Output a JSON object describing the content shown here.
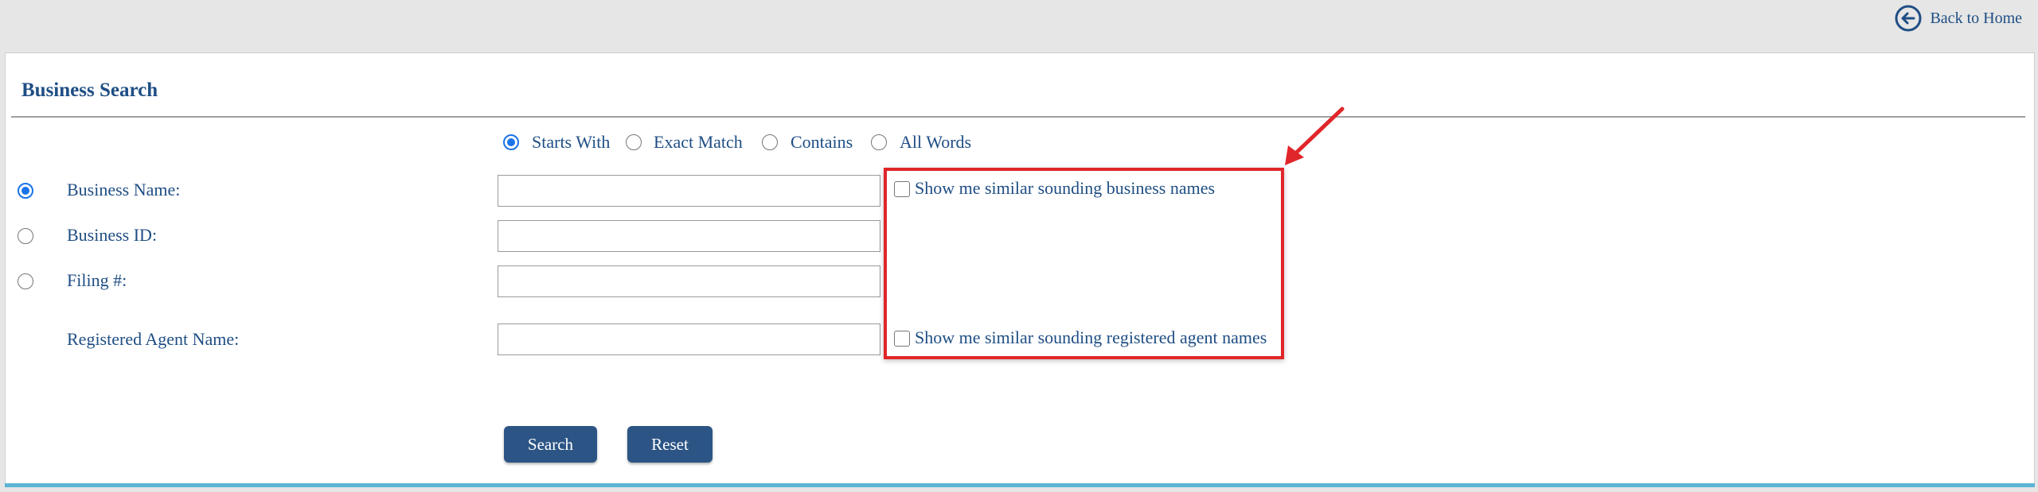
{
  "header": {
    "back_label": "Back to Home",
    "back_icon": "arrow-left-circle-icon"
  },
  "page": {
    "title": "Business Search"
  },
  "match_options": {
    "selected": "Starts With",
    "items": [
      "Starts With",
      "Exact Match",
      "Contains",
      "All Words"
    ]
  },
  "search_by": {
    "selected": "Business Name",
    "fields": [
      {
        "label": "Business Name:",
        "value": "",
        "placeholder": ""
      },
      {
        "label": "Business ID:",
        "value": "",
        "placeholder": ""
      },
      {
        "label": "Filing #:",
        "value": "",
        "placeholder": ""
      }
    ]
  },
  "agent": {
    "label": "Registered Agent Name:",
    "value": "",
    "placeholder": ""
  },
  "checkboxes": {
    "similar_business": {
      "label": "Show me similar sounding business names",
      "checked": false
    },
    "similar_agent": {
      "label": "Show me similar sounding registered agent names",
      "checked": false
    }
  },
  "buttons": {
    "search": "Search",
    "reset": "Reset"
  },
  "colors": {
    "accent": "#1f4e84",
    "button": "#2c5585",
    "highlight": "#e0262a",
    "radio_selected": "#1a73e8",
    "bottom_border": "#5ab4d4"
  }
}
